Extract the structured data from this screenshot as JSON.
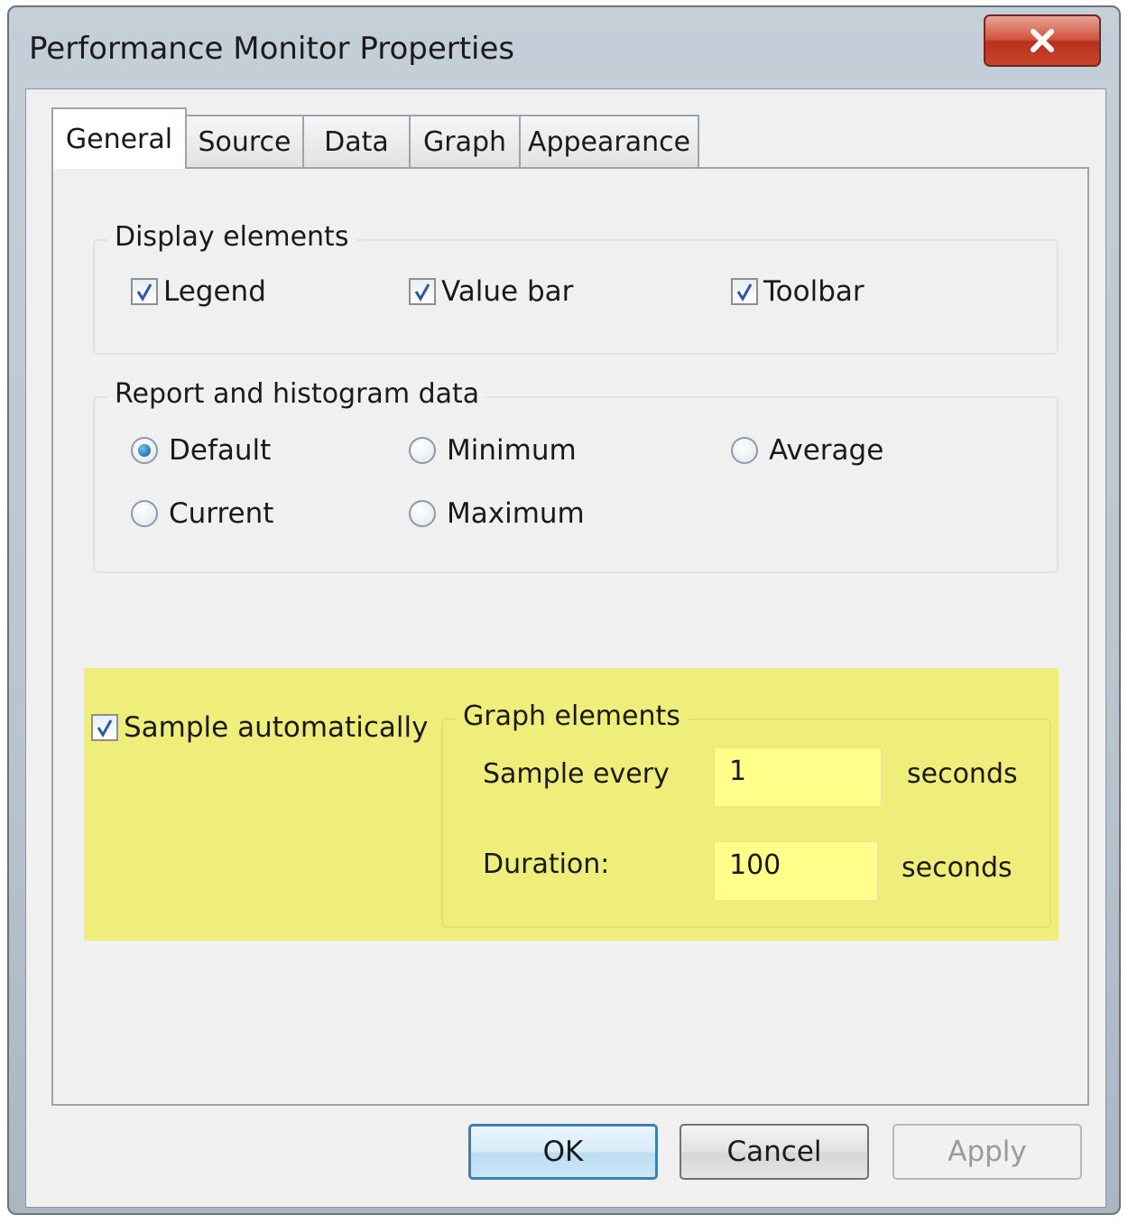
{
  "window": {
    "title": "Performance Monitor Properties",
    "close_icon": "close-x-icon"
  },
  "tabs": [
    {
      "label": "General",
      "active": true
    },
    {
      "label": "Source",
      "active": false
    },
    {
      "label": "Data",
      "active": false
    },
    {
      "label": "Graph",
      "active": false
    },
    {
      "label": "Appearance",
      "active": false
    }
  ],
  "display_elements": {
    "label": "Display elements",
    "legend": {
      "label": "Legend",
      "checked": true
    },
    "value_bar": {
      "label": "Value bar",
      "checked": true
    },
    "toolbar": {
      "label": "Toolbar",
      "checked": true
    }
  },
  "report_data": {
    "label": "Report and histogram data",
    "default": {
      "label": "Default",
      "selected": true
    },
    "minimum": {
      "label": "Minimum",
      "selected": false
    },
    "average": {
      "label": "Average",
      "selected": false
    },
    "current": {
      "label": "Current",
      "selected": false
    },
    "maximum": {
      "label": "Maximum",
      "selected": false
    }
  },
  "sampling": {
    "highlight_color": "#f0ee7a",
    "sample_automatically": {
      "label": "Sample automatically",
      "checked": true
    },
    "graph_elements": {
      "label": "Graph elements",
      "sample_every_label": "Sample every",
      "sample_every_value": "1",
      "sample_every_unit": "seconds",
      "duration_label": "Duration:",
      "duration_value": "100",
      "duration_unit": "seconds"
    }
  },
  "buttons": {
    "ok": "OK",
    "cancel": "Cancel",
    "apply": "Apply"
  }
}
